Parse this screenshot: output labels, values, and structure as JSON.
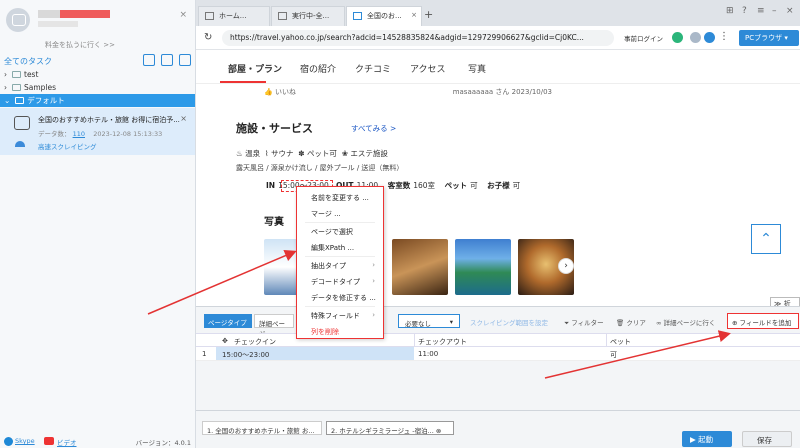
{
  "sidebar": {
    "pay_link": "料金を払うに行く >>",
    "close_icon": "×",
    "all_tasks": "全てのタスク",
    "tree": [
      {
        "label": "test",
        "expanded": false
      },
      {
        "label": "Samples",
        "expanded": false
      },
      {
        "label": "デフォルト",
        "expanded": true,
        "selected": true
      }
    ],
    "task": {
      "title": "全国のおすすめホテル・旅館 お得に宿泊予...",
      "data_label": "データ数：",
      "data_count": "110",
      "timestamp": "2023-12-08 15:13:33",
      "mode": "高速スクレイピング"
    },
    "footer": {
      "skype": "Skype",
      "video": "ビデオ",
      "version": "バージョン：4.0.1"
    }
  },
  "tabs": [
    {
      "label": "ホーム...",
      "active": false
    },
    {
      "label": "実行中-全...",
      "active": false
    },
    {
      "label": "全国のお...",
      "active": true
    }
  ],
  "address_bar": {
    "url": "https://travel.yahoo.co.jp/search?adcid=14528835824&adgid=129729906627&gclid=Cj0KC...",
    "pre_login": "事前ログイン",
    "pc_browser": "PCブラウザ"
  },
  "web": {
    "nav": [
      "部屋・プラン",
      "宿の紹介",
      "クチコミ",
      "アクセス",
      "写真"
    ],
    "iine": "いいね",
    "review_meta": "masaaaaaa さん 2023/10/03",
    "section_title": "施設・サービス",
    "see_all": "すべてみる >",
    "amenities": [
      "温泉",
      "サウナ",
      "ペット可",
      "エステ施設"
    ],
    "amenities2": "露天風呂 / 源泉かけ流し / 屋外プール / 送迎（無料）",
    "check": {
      "in_label": "IN",
      "in_value": "15:00～23:00",
      "out_label": "OUT",
      "out_value": "11:00",
      "rooms_label": "客室数",
      "rooms_value": "160室",
      "pet_label": "ペット",
      "pet_value": "可",
      "kids_label": "お子様",
      "kids_value": "可"
    },
    "photos_title": "写真",
    "fold": "折る"
  },
  "context_menu": {
    "items": [
      {
        "label": "名前を変更する ...",
        "submenu": false
      },
      {
        "label": "マージ ...",
        "submenu": false
      },
      {
        "label": "ページで選択",
        "submenu": false
      },
      {
        "label": "編集XPath ...",
        "submenu": false
      },
      {
        "label": "抽出タイプ",
        "submenu": true
      },
      {
        "label": "デコードタイプ",
        "submenu": true
      },
      {
        "label": "データを修正する ...",
        "submenu": false
      },
      {
        "label": "特殊フィールド",
        "submenu": true
      },
      {
        "label": "列を削除",
        "submenu": false,
        "danger": true
      }
    ]
  },
  "panel": {
    "page_type": "ページタイプ",
    "detail_page": "詳細ページ",
    "need_select": "必要なし",
    "scroll_range": "スクレイピング範囲を設定",
    "filter": "フィルター",
    "clear": "クリア",
    "goto_detail": "詳細ページに行く",
    "add_field": "フィールドを追加",
    "columns": [
      "チェックイン",
      "チェックアウト",
      "ペット"
    ],
    "rows": [
      {
        "index": "1",
        "values": [
          "15:00～23:00",
          "11:00",
          "可"
        ]
      }
    ]
  },
  "bottom": {
    "tabs": [
      "1. 全国のおすすめホテル・旅館 お...",
      "2. ホテルシギラミラージュ -宿泊..."
    ],
    "start": "▶ 起動",
    "save": "保存"
  },
  "colors": {
    "accent": "#2d8ad7",
    "highlight": "#e33333",
    "selected_row": "#2d9ae8"
  }
}
